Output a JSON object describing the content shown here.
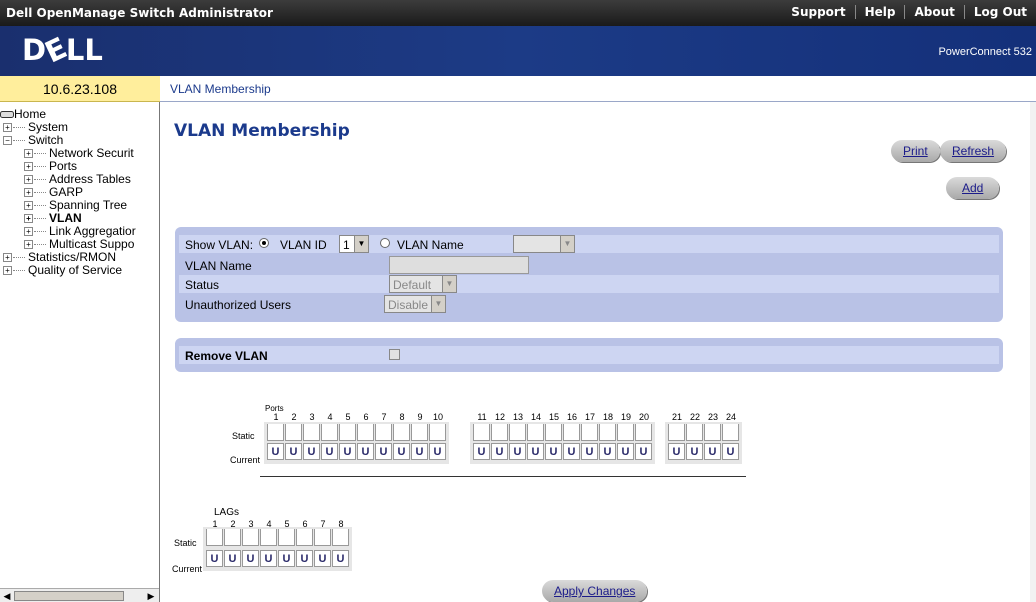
{
  "topbar": {
    "app_title": "Dell OpenManage Switch Administrator",
    "nav": [
      "Support",
      "Help",
      "About",
      "Log Out"
    ]
  },
  "brand": {
    "logo": "DELL",
    "product": "PowerConnect 532"
  },
  "left": {
    "ip": "10.6.23.108",
    "tree": [
      {
        "label": "Home",
        "icon": "drive-icon"
      },
      {
        "label": "System"
      },
      {
        "label": "Switch"
      },
      {
        "label": "Network Securit"
      },
      {
        "label": "Ports"
      },
      {
        "label": "Address Tables"
      },
      {
        "label": "GARP"
      },
      {
        "label": "Spanning Tree"
      },
      {
        "label": "VLAN"
      },
      {
        "label": "Link Aggregatior"
      },
      {
        "label": "Multicast Suppo"
      },
      {
        "label": "Statistics/RMON"
      },
      {
        "label": "Quality of Service"
      }
    ]
  },
  "breadcrumb": "VLAN Membership",
  "main": {
    "title": "VLAN Membership",
    "buttons": {
      "print": "Print",
      "refresh": "Refresh",
      "add": "Add",
      "apply": "Apply Changes"
    },
    "form": {
      "show_vlan_label": "Show VLAN:",
      "vlan_id_label": "VLAN ID",
      "vlan_id_value": "1",
      "vlan_name_radio_label": "VLAN Name",
      "vlan_name_select_value": "",
      "vlan_name_label": "VLAN Name",
      "vlan_name_value": "",
      "status_label": "Status",
      "status_value": "Default",
      "unauth_label": "Unauthorized Users",
      "unauth_value": "Disable"
    },
    "remove_vlan_label": "Remove VLAN",
    "ports": {
      "caption": "Ports",
      "static_label": "Static",
      "current_label": "Current",
      "numbers": [
        "1",
        "2",
        "3",
        "4",
        "5",
        "6",
        "7",
        "8",
        "9",
        "10",
        "11",
        "12",
        "13",
        "14",
        "15",
        "16",
        "17",
        "18",
        "19",
        "20",
        "21",
        "22",
        "23",
        "24"
      ],
      "current_values": [
        "U",
        "U",
        "U",
        "U",
        "U",
        "U",
        "U",
        "U",
        "U",
        "U",
        "U",
        "U",
        "U",
        "U",
        "U",
        "U",
        "U",
        "U",
        "U",
        "U",
        "U",
        "U",
        "U",
        "U"
      ]
    },
    "lags": {
      "caption": "LAGs",
      "static_label": "Static",
      "current_label": "Current",
      "numbers": [
        "1",
        "2",
        "3",
        "4",
        "5",
        "6",
        "7",
        "8"
      ],
      "current_values": [
        "U",
        "U",
        "U",
        "U",
        "U",
        "U",
        "U",
        "U"
      ]
    }
  }
}
